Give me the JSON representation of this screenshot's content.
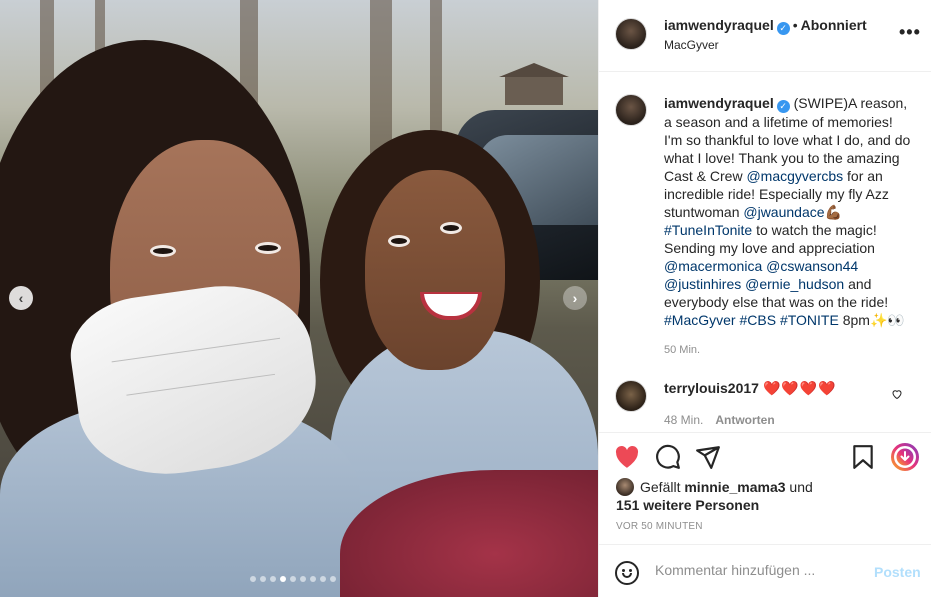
{
  "post": {
    "username": "iamwendyraquel",
    "verified": true,
    "follow_status": "Abonniert",
    "location": "MacGyver",
    "more_icon": "more-horizontal-icon"
  },
  "caption": {
    "username": "iamwendyraquel",
    "part1": "(SWIPE)A reason, a season and a lifetime of memories! I'm so thankful to love what I do, and do what I love! Thank you to the amazing Cast & Crew ",
    "mention1": "@macgyvercbs",
    "part2": " for an incredible ride! Especially my fly Azz stuntwoman ",
    "mention2": "@jwaundace",
    "emoji1": "💪🏾",
    "part3": " ",
    "hashtag1": "#TuneInTonite",
    "part4": " to watch the magic! Sending my love and appreciation ",
    "mention3": "@macermonica",
    "mention4": "@cswanson44",
    "mention5": "@justinhires",
    "mention6": "@ernie_hudson",
    "part5": " and everybody else that was on the ride! ",
    "hashtag2": "#MacGyver",
    "hashtag3": "#CBS",
    "hashtag4": "#TONITE",
    "part6": " 8pm",
    "emoji2": "✨👀",
    "time": "50 Min."
  },
  "comment": {
    "username": "terrylouis2017",
    "text": "❤️❤️❤️❤️",
    "time": "48 Min.",
    "reply_label": "Antworten"
  },
  "likes": {
    "prefix": "Gefällt",
    "user": "minnie_mama3",
    "conj": "und",
    "others": "151 weitere Personen"
  },
  "timestamp": "VOR 50 MINUTEN",
  "comment_input": {
    "placeholder": "Kommentar hinzufügen ...",
    "post_label": "Posten"
  },
  "carousel": {
    "total": 9,
    "active_index": 3
  },
  "colors": {
    "like_red": "#ed4956",
    "link_blue": "#00376b",
    "verified_blue": "#3897f0",
    "post_disabled": "#b2dffc"
  }
}
